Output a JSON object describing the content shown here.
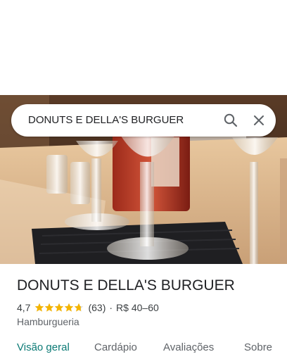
{
  "search": {
    "query": "DONUTS E DELLA'S BURGUER",
    "search_icon": "search-icon",
    "close_icon": "close-icon"
  },
  "photo": {
    "description_icon": "place-photo"
  },
  "place": {
    "name": "DONUTS E DELLA'S BURGUER",
    "rating": "4,7",
    "rating_value": 4.7,
    "stars_max": 5,
    "review_count": "(63)",
    "separator": "·",
    "price_range": "R$ 40–60",
    "category": "Hamburgueria",
    "star_color": "#f4b400"
  },
  "tabs": [
    {
      "label": "Visão geral",
      "active": true
    },
    {
      "label": "Cardápio",
      "active": false
    },
    {
      "label": "Avaliações",
      "active": false
    },
    {
      "label": "Sobre",
      "active": false
    }
  ],
  "colors": {
    "accent": "#0b7a75",
    "text": "#202124",
    "secondary": "#5f6368"
  }
}
